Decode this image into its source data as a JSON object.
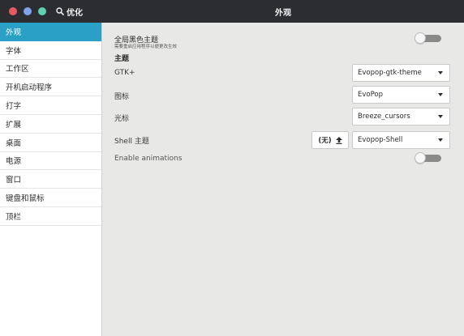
{
  "titlebar": {
    "search_label": "优化",
    "window_title": "外观"
  },
  "sidebar": {
    "items": [
      {
        "label": "外观",
        "active": true
      },
      {
        "label": "字体"
      },
      {
        "label": "工作区"
      },
      {
        "label": "开机启动程序"
      },
      {
        "label": "打字"
      },
      {
        "label": "扩展"
      },
      {
        "label": "桌面"
      },
      {
        "label": "电源"
      },
      {
        "label": "窗口"
      },
      {
        "label": "键盘和鼠标"
      },
      {
        "label": "顶栏"
      }
    ]
  },
  "main": {
    "dark_theme": {
      "label": "全局黑色主题",
      "sublabel": "需要重启应用程序以便更改生效",
      "enabled": false
    },
    "themes_heading": "主题",
    "gtk": {
      "label": "GTK+",
      "value": "Evopop-gtk-theme"
    },
    "icons": {
      "label": "图标",
      "value": "EvoPop"
    },
    "cursor": {
      "label": "光标",
      "value": "Breeze_cursors"
    },
    "shell": {
      "label": "Shell 主题",
      "reset_label": "(无)",
      "value": "Evopop-Shell"
    },
    "animations": {
      "label": "Enable animations",
      "enabled": false
    }
  },
  "colors": {
    "titlebar_bg": "#2b2d30",
    "accent": "#2aa0c7",
    "content_bg": "#e8e8e7"
  }
}
